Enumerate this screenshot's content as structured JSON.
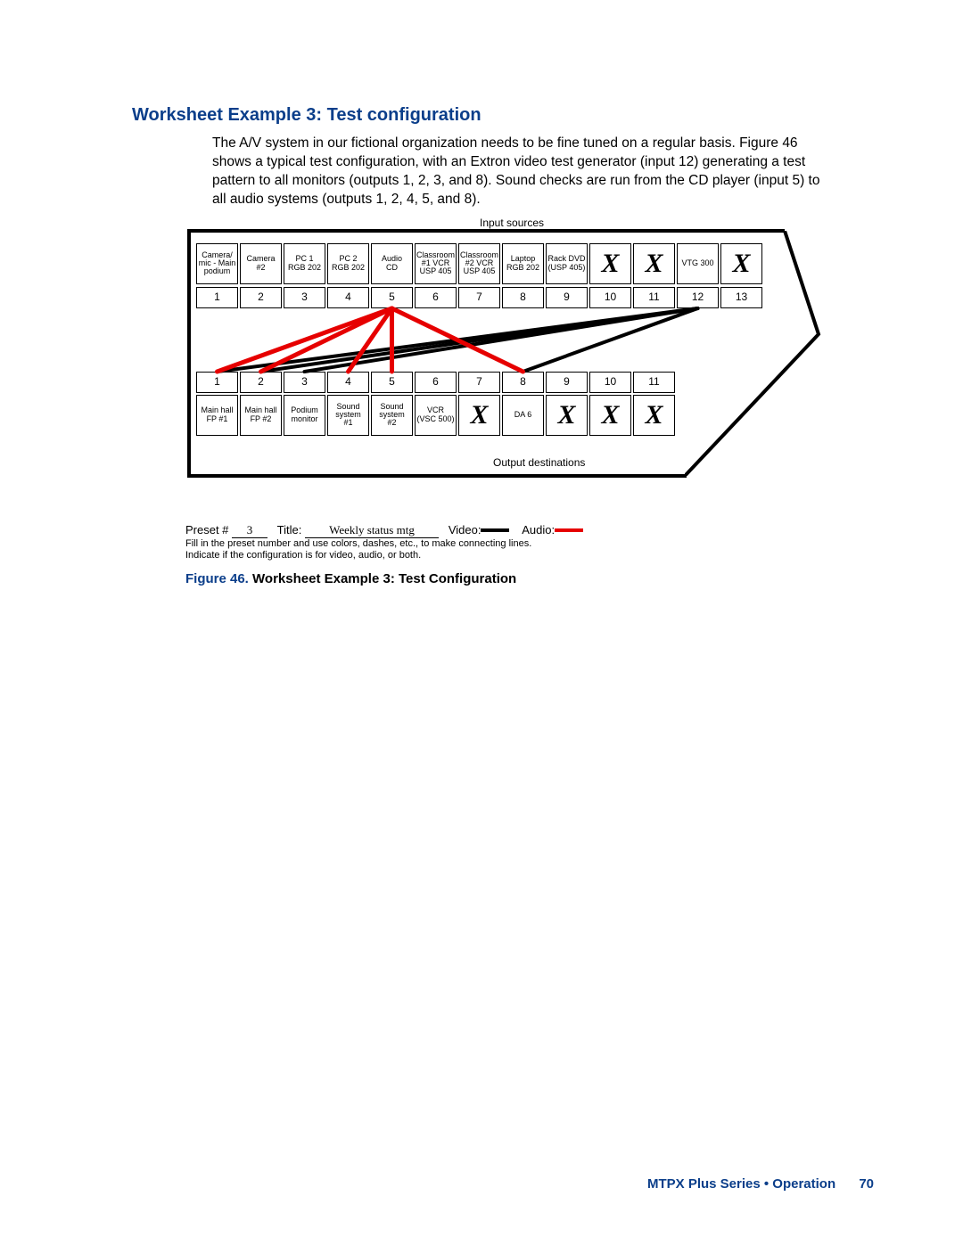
{
  "heading": "Worksheet Example 3: Test configuration",
  "body_text": "The A/V system in our fictional organization needs to be fine tuned on a regular basis. Figure 46 shows a typical test configuration, with an Extron video test generator (input 12) generating a test pattern to all monitors (outputs 1, 2, 3, and 8). Sound checks are run from the CD player (input 5) to all audio systems (outputs 1, 2, 4, 5, and 8).",
  "diagram": {
    "inputs_title": "Input sources",
    "outputs_title": "Output destinations",
    "inputs": [
      {
        "n": "1",
        "label": "Camera/\nmic - Main\npodium"
      },
      {
        "n": "2",
        "label": "Camera\n#2"
      },
      {
        "n": "3",
        "label": "PC 1\nRGB 202"
      },
      {
        "n": "4",
        "label": "PC 2\nRGB 202"
      },
      {
        "n": "5",
        "label": "Audio\nCD"
      },
      {
        "n": "6",
        "label": "Classroom\n#1 VCR\nUSP 405"
      },
      {
        "n": "7",
        "label": "Classroom\n#2 VCR\nUSP 405"
      },
      {
        "n": "8",
        "label": "Laptop\nRGB 202"
      },
      {
        "n": "9",
        "label": "Rack DVD\n(USP 405)"
      },
      {
        "n": "10",
        "label": "X"
      },
      {
        "n": "11",
        "label": "X"
      },
      {
        "n": "12",
        "label": "VTG 300"
      },
      {
        "n": "13",
        "label": "X"
      }
    ],
    "outputs": [
      {
        "n": "1",
        "label": "Main hall\nFP #1"
      },
      {
        "n": "2",
        "label": "Main hall\nFP #2"
      },
      {
        "n": "3",
        "label": "Podium\nmonitor"
      },
      {
        "n": "4",
        "label": "Sound\nsystem\n#1"
      },
      {
        "n": "5",
        "label": "Sound\nsystem\n#2"
      },
      {
        "n": "6",
        "label": "VCR\n(VSC 500)"
      },
      {
        "n": "7",
        "label": "X"
      },
      {
        "n": "8",
        "label": "DA 6"
      },
      {
        "n": "9",
        "label": "X"
      },
      {
        "n": "10",
        "label": "X"
      },
      {
        "n": "11",
        "label": "X"
      }
    ],
    "connections_video": [
      {
        "from_input": 12,
        "to_output": 1
      },
      {
        "from_input": 12,
        "to_output": 2
      },
      {
        "from_input": 12,
        "to_output": 3
      },
      {
        "from_input": 12,
        "to_output": 8
      }
    ],
    "connections_audio": [
      {
        "from_input": 5,
        "to_output": 1
      },
      {
        "from_input": 5,
        "to_output": 2
      },
      {
        "from_input": 5,
        "to_output": 4
      },
      {
        "from_input": 5,
        "to_output": 5
      },
      {
        "from_input": 5,
        "to_output": 8
      }
    ]
  },
  "preset": {
    "label_preset": "Preset #",
    "preset_value": "3",
    "label_title": "Title:",
    "title_value": "Weekly status mtg",
    "label_video": "Video:",
    "label_audio": "Audio:",
    "help1": "Fill in the preset number and use colors, dashes, etc., to make connecting lines.",
    "help2": "Indicate if the configuration is for video, audio, or both."
  },
  "caption": {
    "fig": "Figure 46.",
    "text": "Worksheet Example 3: Test Configuration"
  },
  "footer": {
    "text": "MTPX Plus Series • Operation",
    "page": "70"
  }
}
